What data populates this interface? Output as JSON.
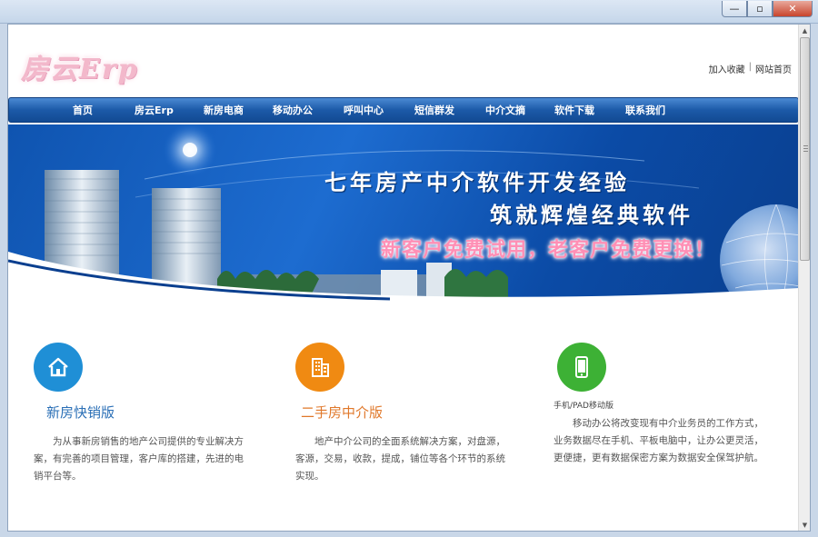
{
  "window": {
    "controls": {
      "minimize": "—",
      "maximize": "▫",
      "close": "✕"
    }
  },
  "logo": {
    "text": "房云Erp"
  },
  "top_links": [
    {
      "label": "加入收藏"
    },
    {
      "label": "网站首页"
    }
  ],
  "top_links_separator": "|",
  "nav": {
    "items": [
      {
        "label": "首页"
      },
      {
        "label": "房云Erp"
      },
      {
        "label": "新房电商"
      },
      {
        "label": "移动办公"
      },
      {
        "label": "呼叫中心"
      },
      {
        "label": "短信群发"
      },
      {
        "label": "中介文摘"
      },
      {
        "label": "软件下载"
      },
      {
        "label": "联系我们"
      }
    ]
  },
  "banner": {
    "line1": "七年房产中介软件开发经验",
    "line2": "筑就辉煌经典软件",
    "line3": "新客户免费试用，老客户免费更换！"
  },
  "features": [
    {
      "title": "新房快销版",
      "description": "为从事新房销售的地产公司提供的专业解决方案，有完善的项目管理，客户库的搭建，先进的电销平台等。",
      "icon": "home-icon",
      "color": "#1f8fd6"
    },
    {
      "title": "二手房中介版",
      "description": "地产中介公司的全面系统解决方案，对盘源，客源，交易，收款，提成，铺位等各个环节的系统实现。",
      "icon": "building-icon",
      "color": "#f08a12"
    },
    {
      "subtitle": "手机/PAD移动版",
      "description": "移动办公将改变现有中介业务员的工作方式，业务数据尽在手机、平板电脑中，让办公更灵活，更便捷，更有数据保密方案为数据安全保驾护航。",
      "icon": "mobile-phone-icon",
      "color": "#3db135"
    }
  ],
  "colors": {
    "nav": "#1c5aa8",
    "banner": "#1d6cd0",
    "accent_pink": "#ff8fb5"
  }
}
